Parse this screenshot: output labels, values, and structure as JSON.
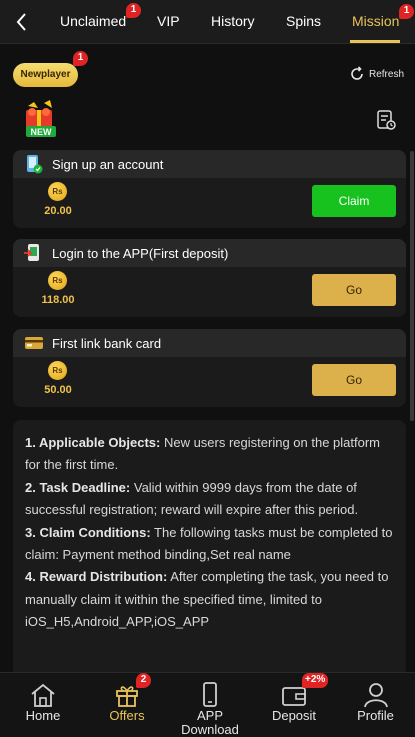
{
  "tabs": [
    {
      "label": "Unclaimed",
      "badge": "1"
    },
    {
      "label": "VIP"
    },
    {
      "label": "History"
    },
    {
      "label": "Spins"
    },
    {
      "label": "Mission",
      "badge": "1"
    }
  ],
  "active_tab": "Mission",
  "header": {
    "newplayer_label": "Newplayer",
    "newplayer_badge": "1",
    "refresh_label": "Refresh",
    "gift_new_label": "NEW"
  },
  "currency_symbol": "Rs",
  "tasks": [
    {
      "title": "Sign up an account",
      "reward": "20.00",
      "button": "Claim",
      "button_state": "claimable"
    },
    {
      "title": "Login to the APP(First deposit)",
      "reward": "118.00",
      "button": "Go",
      "button_state": "go"
    },
    {
      "title": "First link bank card",
      "reward": "50.00",
      "button": "Go",
      "button_state": "go"
    }
  ],
  "rules": [
    {
      "heading": "1. Applicable Objects:",
      "text": " New users registering on the platform for the first time."
    },
    {
      "heading": "2. Task Deadline:",
      "text": " Valid within 9999 days from the date of successful registration; reward will expire after this period."
    },
    {
      "heading": "3. Claim Conditions:",
      "text": " The following tasks must be completed to claim: Payment method binding,Set real name"
    },
    {
      "heading": "4. Reward Distribution:",
      "text": " After completing the task, you need to manually claim it within the specified time, limited to iOS_H5,Android_APP,iOS_APP"
    }
  ],
  "bottom_nav": [
    {
      "label": "Home",
      "icon": "home-icon"
    },
    {
      "label": "Offers",
      "icon": "gift-icon",
      "badge": "2",
      "active": true
    },
    {
      "label": "APP\nDownload",
      "icon": "phone-icon"
    },
    {
      "label": "Deposit",
      "icon": "wallet-icon",
      "badge": "+2%"
    },
    {
      "label": "Profile",
      "icon": "user-icon"
    }
  ],
  "colors": {
    "accent_gold": "#e8c35a",
    "claim_green": "#17c21f",
    "go_gold": "#dcb04a",
    "badge_red": "#e02424",
    "background": "#101010"
  }
}
